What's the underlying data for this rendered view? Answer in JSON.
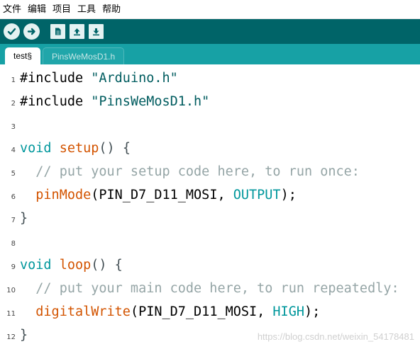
{
  "menu": {
    "items": [
      "文件",
      "编辑",
      "项目",
      "工具",
      "帮助"
    ]
  },
  "toolbar": {
    "buttons": [
      "verify-icon",
      "upload-icon",
      "new-icon",
      "open-icon",
      "save-icon"
    ],
    "accent": "#006468"
  },
  "tabs": [
    {
      "label": "test§",
      "active": true
    },
    {
      "label": "PinsWeMosD1.h",
      "active": false
    }
  ],
  "editor": {
    "lines": [
      {
        "num": "1",
        "tokens": [
          {
            "t": "#include ",
            "c": "id"
          },
          {
            "t": "\"Arduino.h\"",
            "c": "str"
          }
        ]
      },
      {
        "num": "2",
        "tokens": [
          {
            "t": "#include ",
            "c": "id"
          },
          {
            "t": "\"PinsWeMosD1.h\"",
            "c": "str"
          }
        ]
      },
      {
        "num": "3",
        "tokens": []
      },
      {
        "num": "4",
        "tokens": [
          {
            "t": "void",
            "c": "kw"
          },
          {
            "t": " ",
            "c": "id"
          },
          {
            "t": "setup",
            "c": "fn"
          },
          {
            "t": "() {",
            "c": "pn"
          }
        ]
      },
      {
        "num": "5",
        "tokens": [
          {
            "t": "  // put your setup code here, to run once:",
            "c": "cm"
          }
        ]
      },
      {
        "num": "6",
        "tokens": [
          {
            "t": "  ",
            "c": "id"
          },
          {
            "t": "pinMode",
            "c": "fn"
          },
          {
            "t": "(PIN_D7_D11_MOSI, ",
            "c": "id"
          },
          {
            "t": "OUTPUT",
            "c": "const"
          },
          {
            "t": ");",
            "c": "id"
          }
        ]
      },
      {
        "num": "7",
        "tokens": [
          {
            "t": "}",
            "c": "pn"
          }
        ]
      },
      {
        "num": "8",
        "tokens": []
      },
      {
        "num": "9",
        "tokens": [
          {
            "t": "void",
            "c": "kw"
          },
          {
            "t": " ",
            "c": "id"
          },
          {
            "t": "loop",
            "c": "fn"
          },
          {
            "t": "() {",
            "c": "pn"
          }
        ]
      },
      {
        "num": "10",
        "tokens": [
          {
            "t": "  // put your main code here, to run repeatedly:",
            "c": "cm"
          }
        ]
      },
      {
        "num": "11",
        "tokens": [
          {
            "t": "  ",
            "c": "id"
          },
          {
            "t": "digitalWrite",
            "c": "fn"
          },
          {
            "t": "(PIN_D7_D11_MOSI, ",
            "c": "id"
          },
          {
            "t": "HIGH",
            "c": "const"
          },
          {
            "t": ");",
            "c": "id"
          }
        ]
      },
      {
        "num": "12",
        "tokens": [
          {
            "t": "}",
            "c": "pn"
          }
        ]
      }
    ]
  },
  "watermark": "https://blog.csdn.net/weixin_54178481"
}
